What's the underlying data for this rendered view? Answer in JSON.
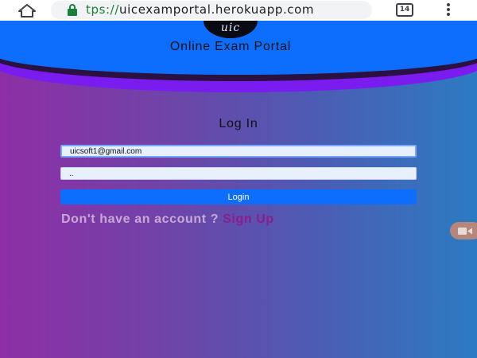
{
  "browser": {
    "url_scheme": "tps://",
    "url_host": "uicexamportal.herokuapp.com",
    "tab_count": "14",
    "icons": {
      "home": "home-icon",
      "lock": "lock-icon",
      "menu": "more-vert-icon"
    }
  },
  "header": {
    "logo_text": "uic",
    "site_title": "Online Exam Portal"
  },
  "login": {
    "heading": "Log In",
    "email_value": "uicsoft1@gmail.com",
    "password_value": "..",
    "submit_label": "Login",
    "no_account_text": "Don't have an account ?",
    "signup_label": "Sign Up"
  },
  "floating": {
    "icon": "video-camera-icon"
  },
  "colors": {
    "header_blue": "#0d6efd",
    "header_purple": "#7a1bf0",
    "gradient_left": "#8e2ea6",
    "gradient_right": "#2c7bc2",
    "signup_link": "#8e1a8e"
  }
}
